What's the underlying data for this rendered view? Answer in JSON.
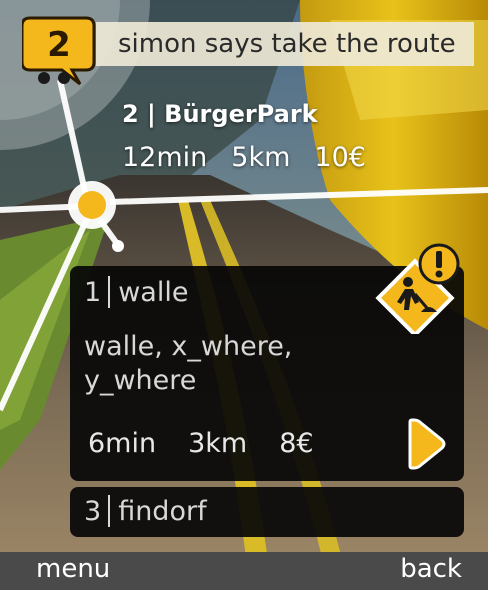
{
  "route_badge": {
    "number": "2"
  },
  "say_bar": {
    "text": "simon says take the route"
  },
  "current_route": {
    "title": "2 | BürgerPark",
    "duration": "12min",
    "distance": "5km",
    "price": "10€"
  },
  "route_list": [
    {
      "number": "1",
      "name": "walle",
      "description": "walle, x_where, y_where",
      "duration": "6min",
      "distance": "3km",
      "price": "8€",
      "warning_icon": "roadworks-warning-icon",
      "next_icon": "play-arrow-icon"
    },
    {
      "number": "3",
      "name": "findorf"
    }
  ],
  "softkeys": {
    "left": "menu",
    "right": "back"
  },
  "colors": {
    "accent": "#F5B81C",
    "say_bar": "#EEE8D6",
    "card": "#080808",
    "softkey_bar": "#4A4A4A"
  }
}
